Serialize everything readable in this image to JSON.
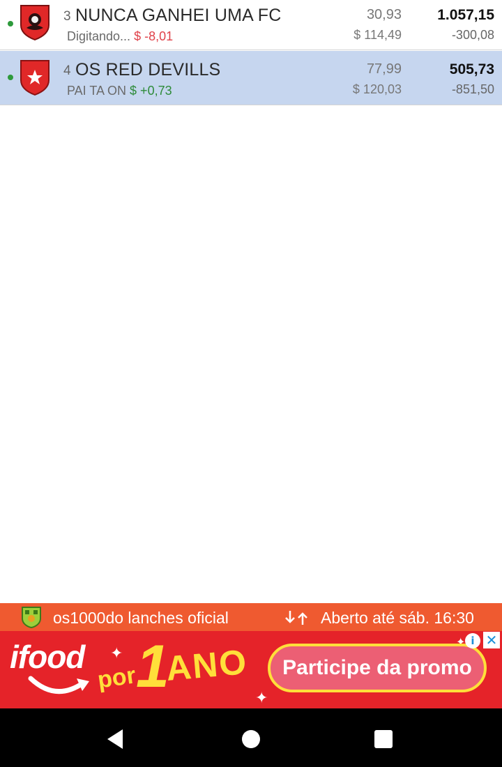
{
  "teams": [
    {
      "rank": "3",
      "name": "NUNCA GANHEI UMA FC",
      "status": "Digitando...",
      "delta": "$ -8,01",
      "delta_sign": "neg",
      "value_a": "30,93",
      "value_b": "$ 114,49",
      "total": "1.057,15",
      "total_delta": "-300,08",
      "online": true,
      "selected": false,
      "shield_icon": "shield-dragon-icon"
    },
    {
      "rank": "4",
      "name": "OS RED DEVILLS",
      "status": "PAI TA ON",
      "delta": "$ +0,73",
      "delta_sign": "pos",
      "value_a": "77,99",
      "value_b": "$ 120,03",
      "total": "505,73",
      "total_delta": "-851,50",
      "online": true,
      "selected": true,
      "shield_icon": "shield-star-icon"
    }
  ],
  "promo_bar": {
    "store_name": "os1000do lanches oficial",
    "hours": "Aberto  até sáb. 16:30",
    "icon": "swap-arrows-icon",
    "background": "#ef5a30"
  },
  "ad": {
    "brand": "ifood",
    "por": "por",
    "number": "1",
    "ano": "ANO",
    "cta": "Participe da promo",
    "info_icon": "i",
    "close_icon": "✕",
    "background": "#e52329"
  },
  "navigation": {
    "back": "back-icon",
    "home": "home-icon",
    "recents": "recents-icon"
  },
  "colors": {
    "selected_row": "#c6d6ef",
    "online_dot": "#2e9a3c",
    "negative": "#e0424a",
    "positive": "#2e8b3a"
  }
}
